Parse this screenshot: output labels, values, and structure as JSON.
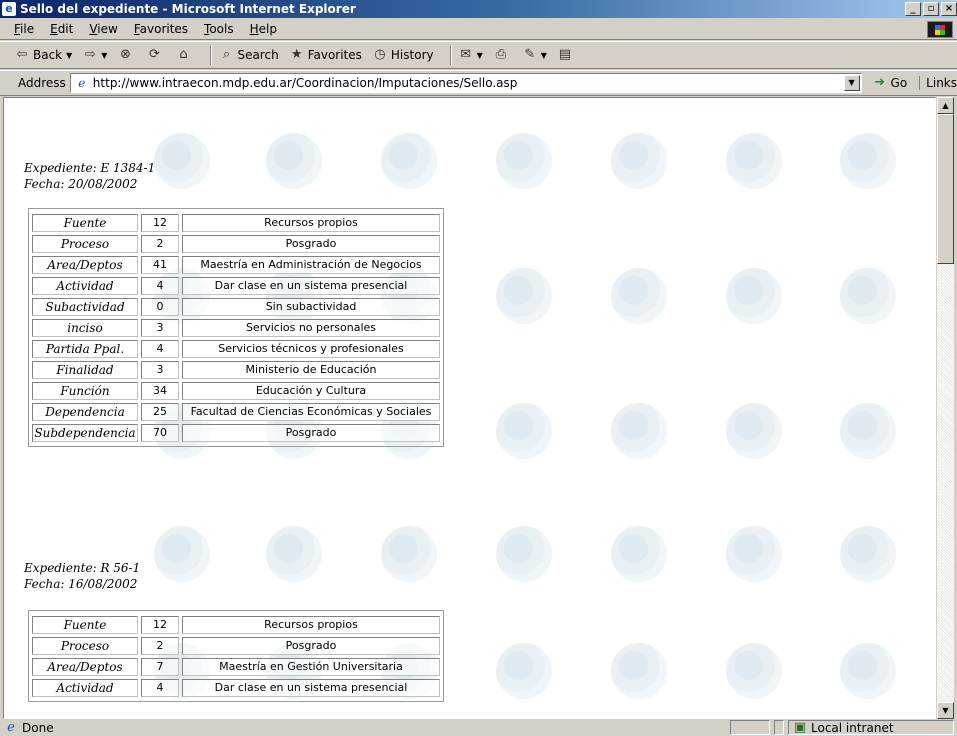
{
  "window": {
    "title": "Sello del expediente - Microsoft Internet Explorer"
  },
  "menu": [
    "File",
    "Edit",
    "View",
    "Favorites",
    "Tools",
    "Help"
  ],
  "toolbar": {
    "back": "Back",
    "search": "Search",
    "favorites": "Favorites",
    "history": "History"
  },
  "address": {
    "label": "Address",
    "url": "http://www.intraecon.mdp.edu.ar/Coordinacion/Imputaciones/Sello.asp",
    "go": "Go",
    "links": "Links"
  },
  "records": [
    {
      "expediente": "Expediente: E 1384-1",
      "fecha": "Fecha: 20/08/2002",
      "rows": [
        {
          "label": "Fuente",
          "code": "12",
          "desc": "Recursos propios"
        },
        {
          "label": "Proceso",
          "code": "2",
          "desc": "Posgrado"
        },
        {
          "label": "Area/Deptos",
          "code": "41",
          "desc": "Maestría en Administración de Negocios"
        },
        {
          "label": "Actividad",
          "code": "4",
          "desc": "Dar clase en un sistema presencial"
        },
        {
          "label": "Subactividad",
          "code": "0",
          "desc": "Sin subactividad"
        },
        {
          "label": "inciso",
          "code": "3",
          "desc": "Servicios no personales"
        },
        {
          "label": "Partida Ppal.",
          "code": "4",
          "desc": "Servicios técnicos y profesionales"
        },
        {
          "label": "Finalidad",
          "code": "3",
          "desc": "Ministerio de Educación"
        },
        {
          "label": "Función",
          "code": "34",
          "desc": "Educación y Cultura"
        },
        {
          "label": "Dependencia",
          "code": "25",
          "desc": "Facultad de Ciencias Económicas y Sociales"
        },
        {
          "label": "Subdependencia",
          "code": "70",
          "desc": "Posgrado"
        }
      ]
    },
    {
      "expediente": "Expediente: R 56-1",
      "fecha": "Fecha: 16/08/2002",
      "rows": [
        {
          "label": "Fuente",
          "code": "12",
          "desc": "Recursos propios"
        },
        {
          "label": "Proceso",
          "code": "2",
          "desc": "Posgrado"
        },
        {
          "label": "Area/Deptos",
          "code": "7",
          "desc": "Maestría en Gestión Universitaria"
        },
        {
          "label": "Actividad",
          "code": "4",
          "desc": "Dar clase en un sistema presencial"
        }
      ]
    }
  ],
  "status": {
    "text": "Done",
    "zone": "Local intranet"
  }
}
